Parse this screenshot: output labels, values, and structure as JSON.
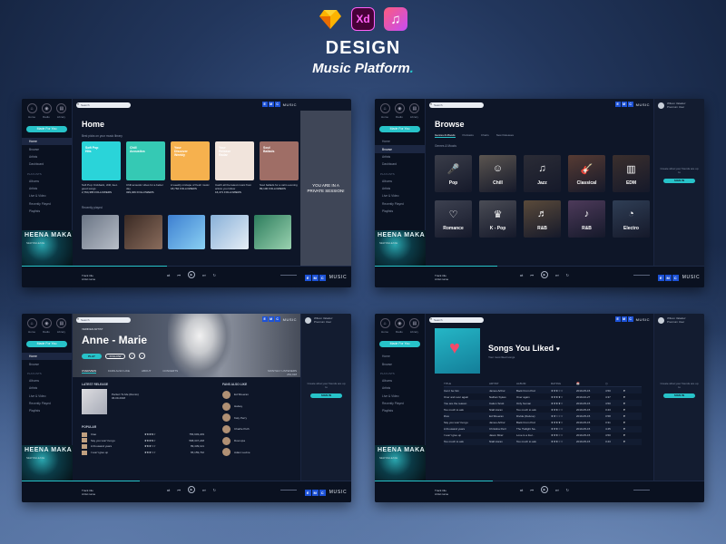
{
  "header": {
    "tools": [
      "sketch-icon",
      "xd-icon",
      "music-icon"
    ],
    "xd_label": "Xd",
    "title": "DESIGN",
    "subtitle": "Music Platform",
    "subtitle_dot": "."
  },
  "brand": {
    "boxes": [
      "E",
      "M",
      "C"
    ],
    "text": "MUSIC"
  },
  "player": {
    "track": "Track title",
    "artist": "Artist name"
  },
  "artwork": {
    "title": "HEENA MAKA",
    "subtitle": "NEW RELEASE"
  },
  "user": {
    "name": "Wilson Valadez",
    "role": "Premium User"
  },
  "colors": {
    "accent": "#27c3c9",
    "brand": "#1d52d6",
    "panel": "#0e1628"
  },
  "sidebar": {
    "nav": [
      "Home",
      "Radio",
      "Library"
    ],
    "cta": "Made For You",
    "items": [
      "Home",
      "Browse",
      "Artists",
      "Dashboard"
    ],
    "playlists_title": "PLAYLISTS",
    "playlists": [
      "Albums",
      "Artists",
      "Live & Video",
      "Recently Played",
      "Playlists"
    ]
  },
  "home": {
    "title": "Home",
    "subtitle": "Best picks on your music library",
    "cards": [
      {
        "label": "Soft Pop Hits",
        "caption": "Soft Pop: Kickback, chill, feel-good songs",
        "followers": "2,764,365 FOLLOWERS",
        "color": "#2ad4d9"
      },
      {
        "label": "Chill Acoustics",
        "caption": "Chill acoustic vibes for a better day",
        "followers": "329,326 FOLLOWERS",
        "color": "#35c9b4"
      },
      {
        "label": "Your Discover Weekly",
        "caption": "A weekly mixtape of fresh music",
        "followers": "18,762 FOLLOWERS",
        "color": "#f6b14e"
      },
      {
        "label": "Your Release Radar",
        "caption": "Catch all the latest music from artists you follow",
        "followers": "16,471 FOLLOWERS",
        "color": "#f1e4dc"
      },
      {
        "label": "Soul Ballads",
        "caption": "Soul ballads for a calm evening",
        "followers": "89,100 FOLLOWERS",
        "color": "#9f6e66"
      }
    ],
    "recent_title": "Recently played",
    "private_session": "YOU ARE IN A PRIVATE SESSION!"
  },
  "browse": {
    "title": "Browse",
    "tabs": [
      "Genres & Moods",
      "Podcasts",
      "Charts",
      "New Releases"
    ],
    "section": "Genres & Moods",
    "genres": [
      {
        "name": "Pop",
        "glyph": "🎤"
      },
      {
        "name": "Chill",
        "glyph": "☺"
      },
      {
        "name": "Jazz",
        "glyph": "♫"
      },
      {
        "name": "Classical",
        "glyph": "🎸"
      },
      {
        "name": "EDM",
        "glyph": "▥"
      },
      {
        "name": "Romance",
        "glyph": "♡"
      },
      {
        "name": "K - Pop",
        "glyph": "♛"
      },
      {
        "name": "R&B",
        "glyph": "♬"
      },
      {
        "name": "R&B",
        "glyph": "♪"
      },
      {
        "name": "Electro",
        "glyph": "◔"
      }
    ],
    "share_note": "Create what your friends are up to",
    "share_btn": "SIGN IN"
  },
  "artist": {
    "verified": "VERIFIED ARTIST",
    "name": "Anne - Marie",
    "play": "PLAY",
    "follow": "FOLLOW",
    "tabs": [
      "OVERVIEW",
      "FANS ALSO LIKE",
      "ABOUT",
      "CONCERTS"
    ],
    "listeners_label": "MONTHLY LISTENERS",
    "listeners": "254,918",
    "latest_title": "LATEST RELEASE",
    "latest_name": "Perfect To Me (Remix)",
    "latest_date": "06.09.2018",
    "popular_title": "POPULAR",
    "popular": [
      {
        "title": "Ciao",
        "rating": "★★★★☆",
        "plays": "756,903,229"
      },
      {
        "title": "Say you won't let go",
        "rating": "★★★★☆",
        "plays": "568,347,248"
      },
      {
        "title": "A thousand years",
        "rating": "★★★☆☆",
        "plays": "89,439,121"
      },
      {
        "title": "I won't give up",
        "rating": "★★★☆☆",
        "plays": "65,159,732"
      }
    ],
    "fans_title": "FANS ALSO LIKE",
    "fans": [
      "Ed Sheeran",
      "Halsey",
      "Katy Perry",
      "Charlie Puth",
      "Dua Lipa",
      "Adam Levine"
    ]
  },
  "songs": {
    "title": "Songs You Liked",
    "subtitle": "Your most liked songs",
    "columns": [
      "TITLE",
      "ARTIST",
      "ALBUM",
      "RATING",
      "📅",
      "◷",
      ""
    ],
    "rows": [
      [
        "Can I be him",
        "James Arthur",
        "Back From Pod",
        "★★★☆☆",
        "2019-05-15",
        "4:50",
        "♥"
      ],
      [
        "Over and over again",
        "Nathan Sykes",
        "Over again",
        "★★★★☆",
        "2019-02-27",
        "4:37",
        "♥"
      ],
      [
        "You are the reason",
        "Calum Scott",
        "Only human",
        "★★★★☆",
        "2019-05-15",
        "4:50",
        "♥"
      ],
      [
        "Too much to ask",
        "Niall Horan",
        "Too much to ask",
        "★★★☆☆",
        "2019-05-15",
        "3:43",
        "♥"
      ],
      [
        "Dive",
        "Ed Sheeran",
        "Divide (Deluxe)",
        "★★☆☆☆",
        "2019-05-15",
        "3:58",
        "♥"
      ],
      [
        "Say you won't let go",
        "James Arthur",
        "Back From Pod",
        "★★★★☆",
        "2019-05-15",
        "3:31",
        "♥"
      ],
      [
        "A thousand years",
        "Christina Perri",
        "The Twilight Sa..",
        "★★★☆☆",
        "2019-05-15",
        "4:45",
        "♥"
      ],
      [
        "I won't give up",
        "Jason Mraz",
        "Love is a four..",
        "★★★☆☆",
        "2019-05-15",
        "4:50",
        "♥"
      ],
      [
        "Too much to ask",
        "Niall Horan",
        "Too much to ask",
        "★★★☆☆",
        "2019-05-15",
        "3:43",
        "♥"
      ]
    ]
  }
}
